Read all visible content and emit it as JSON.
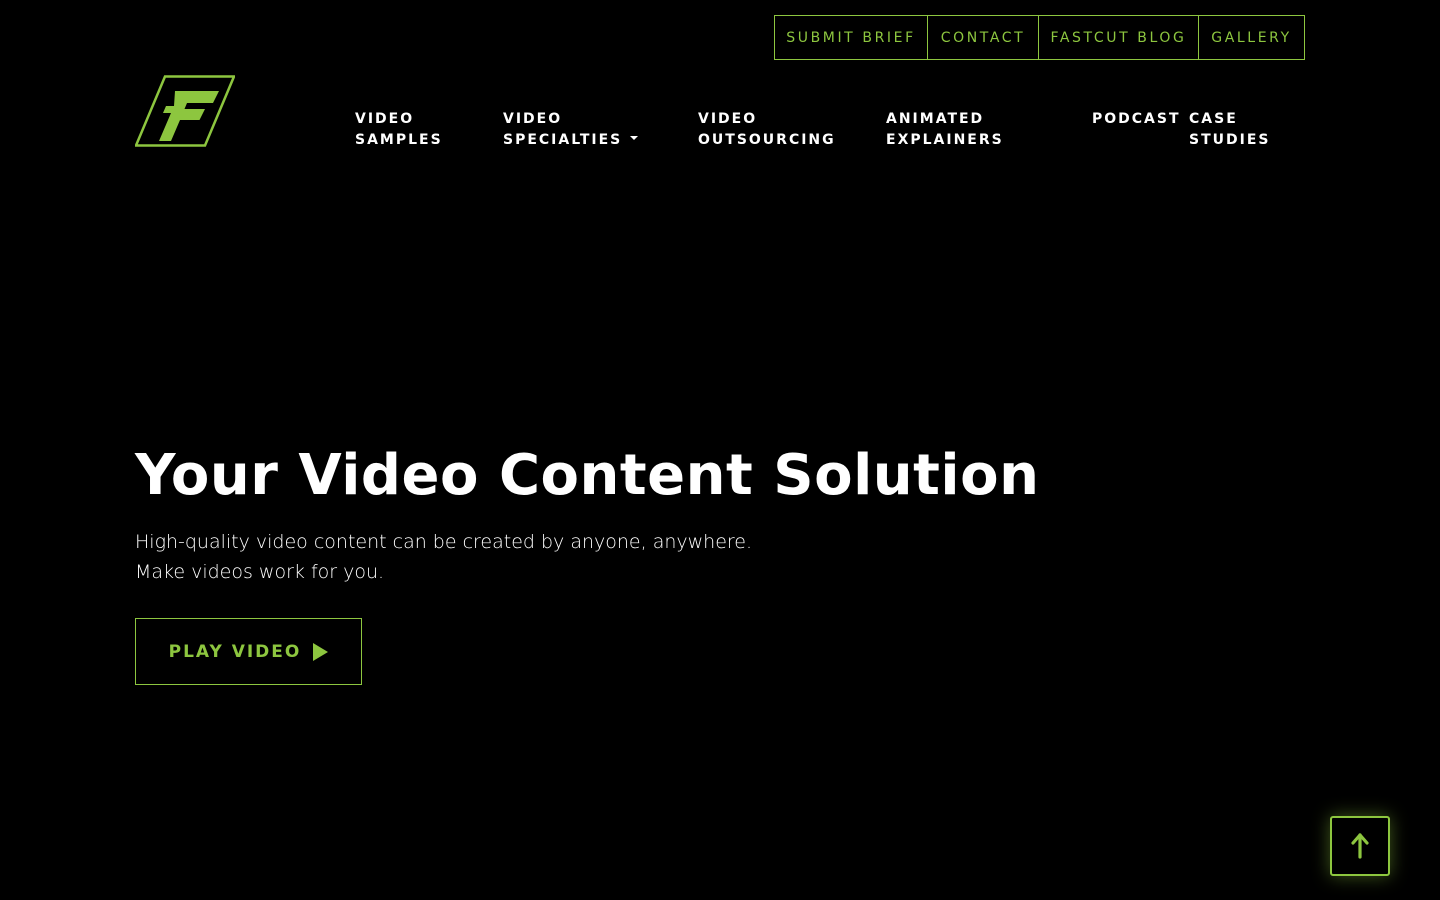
{
  "utility_nav": [
    {
      "label": "SUBMIT BRIEF"
    },
    {
      "label": "CONTACT"
    },
    {
      "label": "FASTCUT BLOG"
    },
    {
      "label": "GALLERY"
    }
  ],
  "main_nav": [
    {
      "line1": "VIDEO",
      "line2": "SAMPLES"
    },
    {
      "line1": "VIDEO",
      "line2": "SPECIALTIES"
    },
    {
      "line1": "VIDEO",
      "line2": "OUTSOURCING"
    },
    {
      "line1": "ANIMATED",
      "line2": "EXPLAINERS"
    },
    {
      "line1": "PODCAST",
      "line2": ""
    },
    {
      "line1": "CASE",
      "line2": "STUDIES"
    }
  ],
  "hero": {
    "title": "Your Video Content Solution",
    "subtitle_line1": "High-quality video content can be created by anyone, anywhere.",
    "subtitle_line2": "Make videos work for you.",
    "cta_label": "PLAY VIDEO"
  },
  "icons": {
    "logo": "fastcut-logo",
    "play": "play-icon",
    "dropdown": "caret-down-icon",
    "scroll_top": "arrow-up-icon"
  },
  "colors": {
    "background": "#000000",
    "accent": "#8dc63f",
    "text": "#ffffff"
  }
}
